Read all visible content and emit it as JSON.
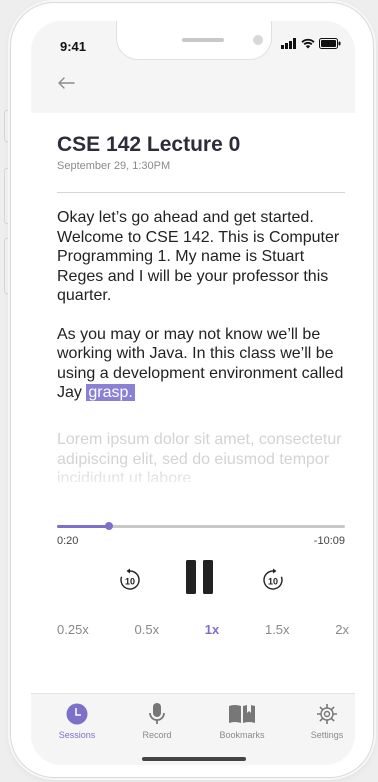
{
  "status": {
    "time": "9:41"
  },
  "lecture": {
    "title": "CSE 142 Lecture 0",
    "date": "September 29, 1:30PM",
    "paragraph1": "Okay let’s go ahead and get started. Welcome to CSE 142. This is Computer Programming 1. My name is Stuart Reges and I will be your professor this quarter.",
    "paragraph2_text": "As you may or may not know we’ll be working with Java. In this class we’ll be using a development environment called Jay",
    "paragraph2_highlight": "grasp.",
    "faded_text": "Lorem ipsum dolor sit amet, consectetur adipiscing elit, sed do eiusmod tempor incididunt ut labore"
  },
  "player": {
    "elapsed": "0:20",
    "remaining": "-10:09",
    "progress_fraction": 0.18,
    "rewind_icon": "rewind-10-icon",
    "pause_icon": "pause-icon",
    "forward_icon": "forward-10-icon",
    "rewind_label": "10",
    "forward_label": "10",
    "speeds": [
      "0.25x",
      "0.5x",
      "1x",
      "1.5x",
      "2x"
    ],
    "active_speed": "1x"
  },
  "tabs": [
    {
      "label": "Sessions",
      "icon": "clock-icon",
      "active": true
    },
    {
      "label": "Record",
      "icon": "microphone-icon",
      "active": false
    },
    {
      "label": "Bookmarks",
      "icon": "book-icon",
      "active": false
    },
    {
      "label": "Settings",
      "icon": "gear-icon",
      "active": false
    }
  ],
  "colors": {
    "accent": "#7d70c8",
    "highlight": "#8a80d4"
  }
}
